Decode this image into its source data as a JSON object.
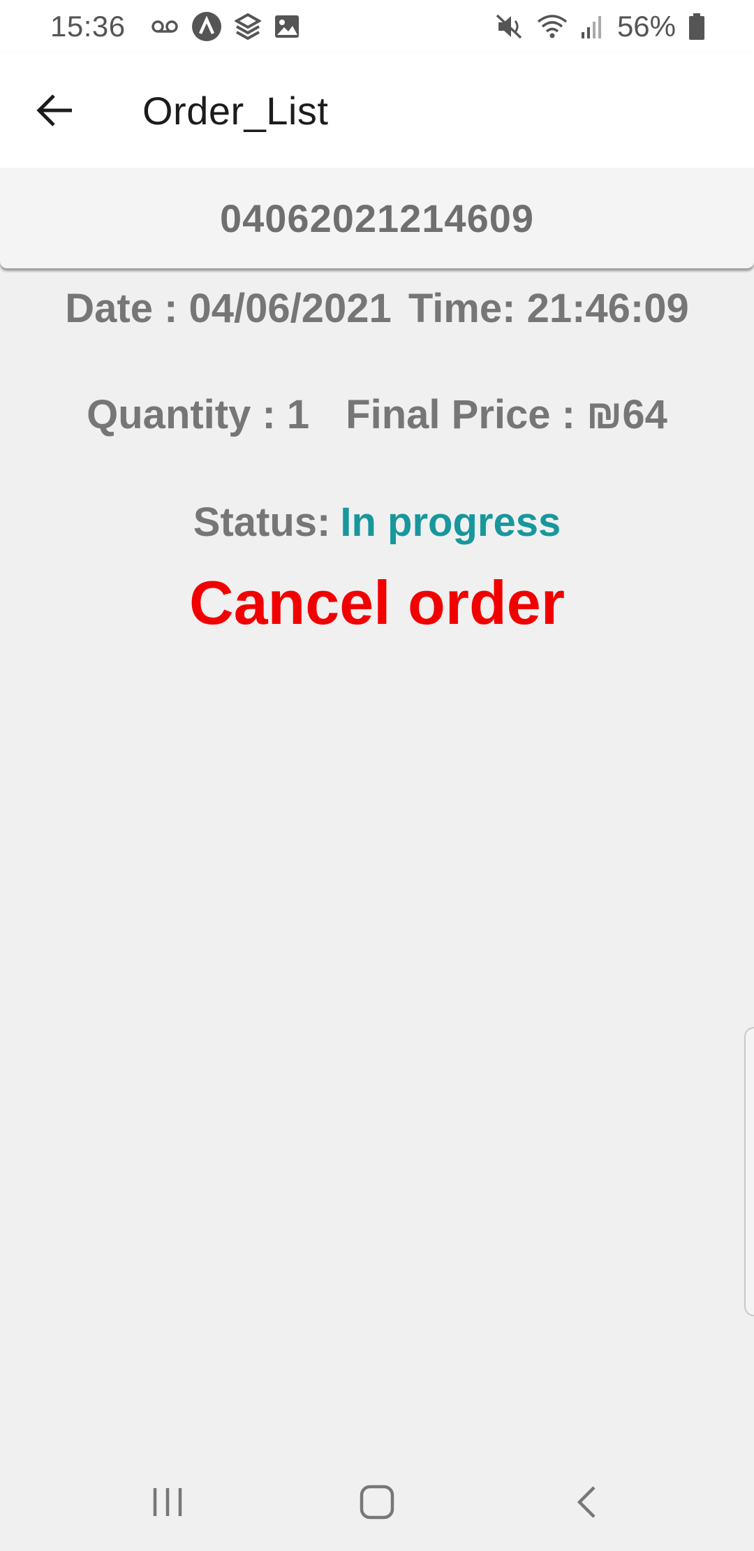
{
  "status_bar": {
    "time": "15:36",
    "battery": "56%",
    "icons": [
      "voicemail-icon",
      "app-a-icon",
      "layers-icon",
      "image-icon",
      "mute-icon",
      "wifi-icon",
      "signal-icon",
      "battery-icon"
    ]
  },
  "app_bar": {
    "title": "Order_List",
    "back_icon": "arrow-left-icon"
  },
  "order": {
    "id": "04062021214609",
    "date_label": "Date : 04/06/2021",
    "time_label": "Time: 21:46:09",
    "quantity_label": "Quantity : 1",
    "price_label": "Final Price : ₪64",
    "status_label": "Status:",
    "status_value": "In progress",
    "cancel_label": "Cancel order"
  },
  "colors": {
    "status_value": "#17979c",
    "cancel": "#f20000",
    "text_gray": "#767676"
  },
  "nav_bar": {
    "icons": [
      "recent-apps-icon",
      "home-icon",
      "back-icon"
    ]
  }
}
